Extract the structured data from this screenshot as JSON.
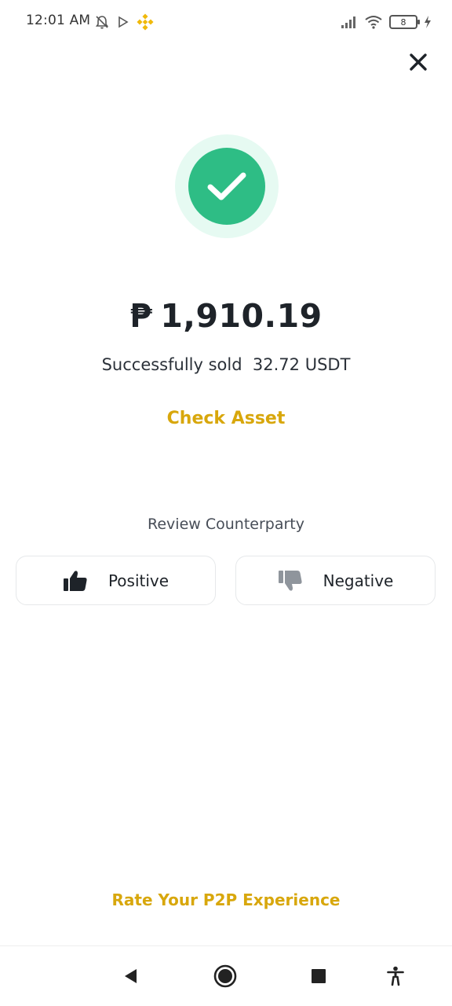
{
  "status_bar": {
    "time": "12:01 AM",
    "battery_level": "8",
    "icons": [
      "notifications-off-icon",
      "play-icon",
      "binance-logo-icon",
      "signal-icon",
      "wifi-icon",
      "battery-icon",
      "charging-icon"
    ]
  },
  "header": {
    "close_icon": "close-icon"
  },
  "result": {
    "status_icon": "checkmark-icon",
    "currency_symbol": "₱",
    "amount": "1,910.19",
    "message": "Successfully sold  32.72 USDT",
    "check_asset_label": "Check Asset"
  },
  "review": {
    "title": "Review Counterparty",
    "positive_label": "Positive",
    "negative_label": "Negative"
  },
  "footer": {
    "rate_label": "Rate Your P2P Experience"
  },
  "nav_bar": {
    "icons": [
      "back-icon",
      "home-icon",
      "recents-icon",
      "accessibility-icon"
    ]
  },
  "colors": {
    "accent_yellow": "#d8a70c",
    "success_green": "#2ebd85",
    "success_halo": "#e6faf2",
    "text_primary": "#1e2329"
  }
}
